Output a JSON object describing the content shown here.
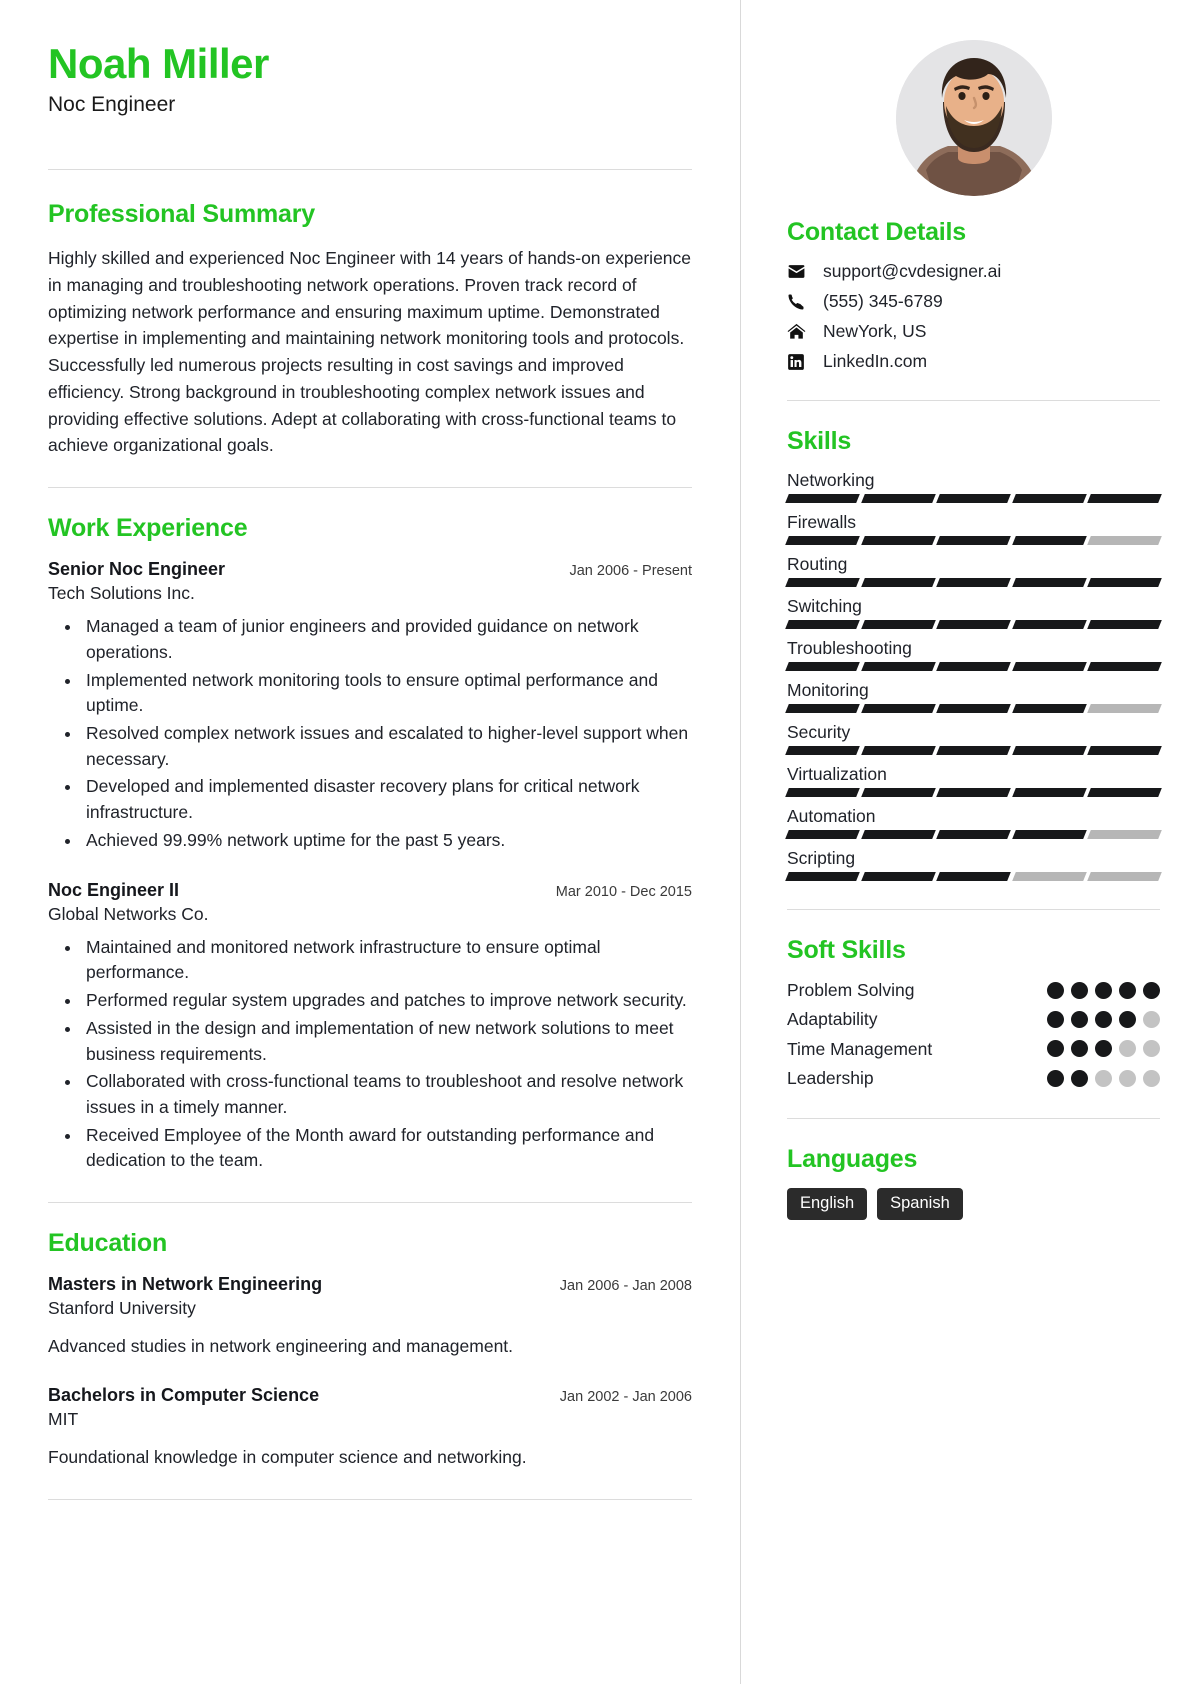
{
  "theme": {
    "accent": "#23c423",
    "bar_on": "#17181a",
    "bar_off": "#b6b6b6",
    "tag_bg": "#2b2b2b"
  },
  "header": {
    "name": "Noah Miller",
    "job_title": "Noc Engineer"
  },
  "summary": {
    "heading": "Professional Summary",
    "text": "Highly skilled and experienced Noc Engineer with 14 years of hands-on experience in managing and troubleshooting network operations. Proven track record of optimizing network performance and ensuring maximum uptime. Demonstrated expertise in implementing and maintaining network monitoring tools and protocols. Successfully led numerous projects resulting in cost savings and improved efficiency. Strong background in troubleshooting complex network issues and providing effective solutions. Adept at collaborating with cross-functional teams to achieve organizational goals."
  },
  "work": {
    "heading": "Work Experience",
    "entries": [
      {
        "role": "Senior Noc Engineer",
        "date": "Jan 2006 - Present",
        "org": "Tech Solutions Inc.",
        "bullets": [
          "Managed a team of junior engineers and provided guidance on network operations.",
          "Implemented network monitoring tools to ensure optimal performance and uptime.",
          "Resolved complex network issues and escalated to higher-level support when necessary.",
          "Developed and implemented disaster recovery plans for critical network infrastructure.",
          "Achieved 99.99% network uptime for the past 5 years."
        ]
      },
      {
        "role": "Noc Engineer II",
        "date": "Mar 2010 - Dec 2015",
        "org": "Global Networks Co.",
        "bullets": [
          "Maintained and monitored network infrastructure to ensure optimal performance.",
          "Performed regular system upgrades and patches to improve network security.",
          "Assisted in the design and implementation of new network solutions to meet business requirements.",
          "Collaborated with cross-functional teams to troubleshoot and resolve network issues in a timely manner.",
          "Received Employee of the Month award for outstanding performance and dedication to the team."
        ]
      }
    ]
  },
  "education": {
    "heading": "Education",
    "entries": [
      {
        "degree": "Masters in Network Engineering",
        "date": "Jan 2006 - Jan 2008",
        "school": "Stanford University",
        "desc": "Advanced studies in network engineering and management."
      },
      {
        "degree": "Bachelors in Computer Science",
        "date": "Jan 2002 - Jan 2006",
        "school": "MIT",
        "desc": "Foundational knowledge in computer science and networking."
      }
    ]
  },
  "contact": {
    "heading": "Contact Details",
    "items": [
      {
        "icon": "envelope-icon",
        "value": "support@cvdesigner.ai"
      },
      {
        "icon": "phone-icon",
        "value": "(555) 345-6789"
      },
      {
        "icon": "home-icon",
        "value": "NewYork, US"
      },
      {
        "icon": "linkedin-icon",
        "value": "LinkedIn.com"
      }
    ]
  },
  "skills": {
    "heading": "Skills",
    "segments_total": 5,
    "items": [
      {
        "name": "Networking",
        "level": 5
      },
      {
        "name": "Firewalls",
        "level": 4
      },
      {
        "name": "Routing",
        "level": 5
      },
      {
        "name": "Switching",
        "level": 5
      },
      {
        "name": "Troubleshooting",
        "level": 5
      },
      {
        "name": "Monitoring",
        "level": 4
      },
      {
        "name": "Security",
        "level": 5
      },
      {
        "name": "Virtualization",
        "level": 5
      },
      {
        "name": "Automation",
        "level": 4
      },
      {
        "name": "Scripting",
        "level": 3
      }
    ]
  },
  "soft_skills": {
    "heading": "Soft Skills",
    "dots_total": 5,
    "items": [
      {
        "name": "Problem Solving",
        "level": 5
      },
      {
        "name": "Adaptability",
        "level": 4
      },
      {
        "name": "Time Management",
        "level": 3
      },
      {
        "name": "Leadership",
        "level": 2
      }
    ]
  },
  "languages": {
    "heading": "Languages",
    "items": [
      "English",
      "Spanish"
    ]
  }
}
